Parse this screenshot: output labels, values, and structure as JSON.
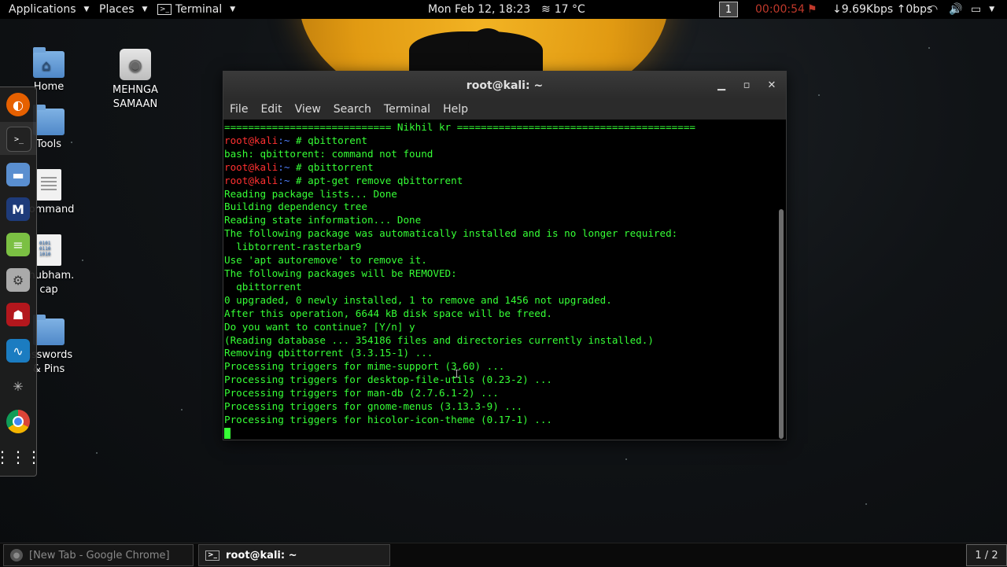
{
  "top_panel": {
    "applications": "Applications",
    "places": "Places",
    "terminal_menu": "Terminal",
    "clock": "Mon Feb 12, 18:23",
    "weather": "17 °C",
    "workspace": "1",
    "rec_timer": "00:00:54",
    "network_speed": "↓9.69Kbps ↑0bps"
  },
  "desktop_icons": [
    {
      "label": "Home"
    },
    {
      "label": "MEHNGA SAMAAN"
    },
    {
      "label": "Tools"
    },
    {
      "label": "command"
    },
    {
      "label": "shubham.\ncap"
    },
    {
      "label": "asswords\n& Pins"
    }
  ],
  "dock": [
    "firefox-icon",
    "terminal-icon",
    "files-icon",
    "metasploit-icon",
    "text-editor-icon",
    "settings-icon",
    "armitage-icon",
    "wireshark-icon",
    "spider-icon",
    "chrome-icon",
    "show-apps-icon"
  ],
  "terminal": {
    "title": "root@kali: ~",
    "menu": [
      "File",
      "Edit",
      "View",
      "Search",
      "Terminal",
      "Help"
    ],
    "prompt_user": "root@kali",
    "prompt_sep": ":~",
    "lines": [
      {
        "type": "text",
        "text": "============================ Nikhil kr ========================================"
      },
      {
        "type": "prompt",
        "cmd": " # qbittorent"
      },
      {
        "type": "text",
        "text": "bash: qbittorent: command not found"
      },
      {
        "type": "prompt",
        "cmd": " # qbittorrent"
      },
      {
        "type": "prompt",
        "cmd": " # apt-get remove qbittorrent"
      },
      {
        "type": "text",
        "text": "Reading package lists... Done"
      },
      {
        "type": "text",
        "text": "Building dependency tree"
      },
      {
        "type": "text",
        "text": "Reading state information... Done"
      },
      {
        "type": "text",
        "text": "The following package was automatically installed and is no longer required:"
      },
      {
        "type": "text",
        "text": "  libtorrent-rasterbar9"
      },
      {
        "type": "text",
        "text": "Use 'apt autoremove' to remove it."
      },
      {
        "type": "text",
        "text": "The following packages will be REMOVED:"
      },
      {
        "type": "text",
        "text": "  qbittorrent"
      },
      {
        "type": "text",
        "text": "0 upgraded, 0 newly installed, 1 to remove and 1456 not upgraded."
      },
      {
        "type": "text",
        "text": "After this operation, 6644 kB disk space will be freed."
      },
      {
        "type": "text",
        "text": "Do you want to continue? [Y/n] y"
      },
      {
        "type": "text",
        "text": "(Reading database ... 354186 files and directories currently installed.)"
      },
      {
        "type": "text",
        "text": "Removing qbittorrent (3.3.15-1) ..."
      },
      {
        "type": "text",
        "text": "Processing triggers for mime-support (3.60) ..."
      },
      {
        "type": "text",
        "text": "Processing triggers for desktop-file-utils (0.23-2) ..."
      },
      {
        "type": "text",
        "text": "Processing triggers for man-db (2.7.6.1-2) ..."
      },
      {
        "type": "text",
        "text": "Processing triggers for gnome-menus (3.13.3-9) ..."
      },
      {
        "type": "text",
        "text": "Processing triggers for hicolor-icon-theme (0.17-1) ..."
      }
    ]
  },
  "taskbar": {
    "chrome_task": "[New Tab - Google Chrome]",
    "terminal_task": "root@kali: ~",
    "pager": "1 / 2"
  }
}
